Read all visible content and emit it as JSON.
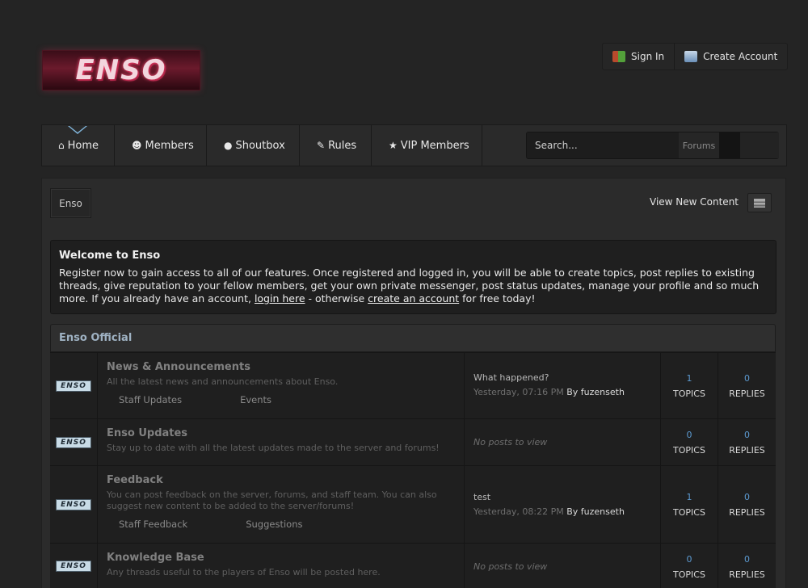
{
  "logo": {
    "text": "ENSO"
  },
  "user_links": {
    "sign_in": "Sign In",
    "create_account": "Create Account"
  },
  "nav": {
    "items": [
      {
        "icon": "⌂",
        "label": "Home"
      },
      {
        "icon": "☻",
        "label": "Members"
      },
      {
        "icon": "●",
        "label": "Shoutbox"
      },
      {
        "icon": "✎",
        "label": "Rules"
      },
      {
        "icon": "★",
        "label": "VIP Members"
      }
    ]
  },
  "search": {
    "placeholder": "Search...",
    "scope": "Forums"
  },
  "breadcrumb": {
    "label": "Enso"
  },
  "view_new": "View New Content",
  "welcome": {
    "title": "Welcome to Enso",
    "text_before": "Register now to gain access to all of our features. Once registered and logged in, you will be able to create topics, post replies to existing threads, give reputation to your fellow members, get your own private messenger, post status updates, manage your profile and so much more. If you already have an account, ",
    "login_link": "login here",
    "text_middle": " - otherwise ",
    "create_link": "create an account",
    "text_after": " for free today!"
  },
  "category": {
    "title": "Enso Official",
    "badge_text": "ENSO",
    "forums": [
      {
        "title": "News & Announcements",
        "desc": "All the latest news and announcements about Enso.",
        "subforums": [
          "Staff Updates",
          "Events"
        ],
        "last_title": "What happened?",
        "last_time": "Yesterday, 07:16 PM",
        "last_by": "By fuzenseth",
        "topics": "1",
        "replies": "0"
      },
      {
        "title": "Enso Updates",
        "desc": "Stay up to date with all the latest updates made to the server and forums!",
        "no_posts": "No posts to view",
        "topics": "0",
        "replies": "0"
      },
      {
        "title": "Feedback",
        "desc": "You can post feedback on the server, forums, and staff team. You can also suggest new content to be added to the server/forums!",
        "subforums": [
          "Staff Feedback",
          "Suggestions"
        ],
        "last_title": "test",
        "last_time": "Yesterday, 08:22 PM",
        "last_by": "By fuzenseth",
        "topics": "1",
        "replies": "0"
      },
      {
        "title": "Knowledge Base",
        "desc": "Any threads useful to the players of Enso will be posted here.",
        "no_posts": "No posts to view",
        "topics": "0",
        "replies": "0"
      }
    ],
    "topics_label": "TOPICS",
    "replies_label": "REPLIES"
  }
}
